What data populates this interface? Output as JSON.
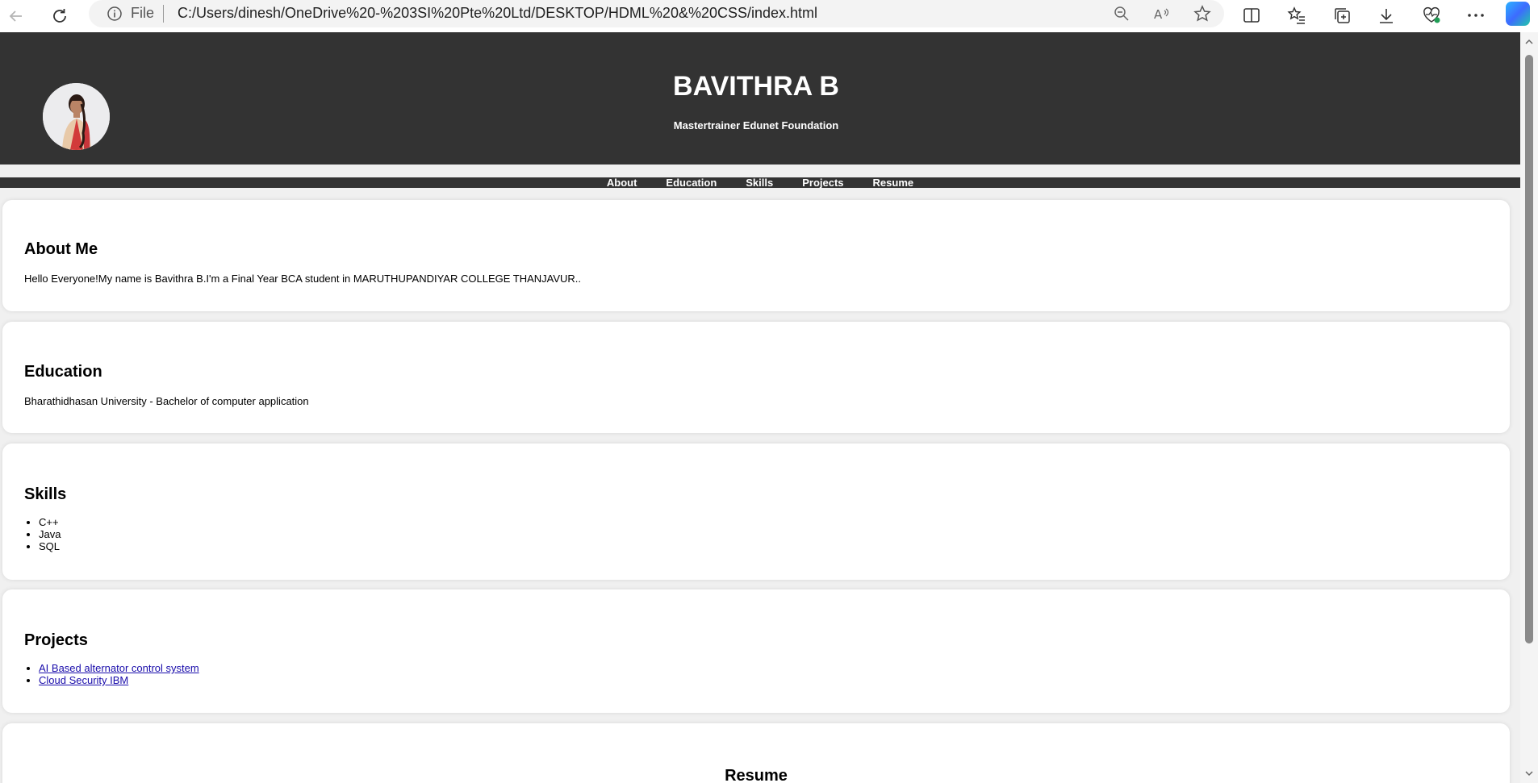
{
  "browser": {
    "address_prefix": "File",
    "url": "C:/Users/dinesh/OneDrive%20-%203SI%20Pte%20Ltd/DESKTOP/HDML%20&%20CSS/index.html"
  },
  "header": {
    "name": "BAVITHRA B",
    "tagline": "Mastertrainer Edunet Foundation"
  },
  "nav": {
    "items": [
      {
        "label": "About"
      },
      {
        "label": "Education"
      },
      {
        "label": "Skills"
      },
      {
        "label": "Projects"
      },
      {
        "label": "Resume"
      }
    ]
  },
  "about": {
    "title": "About Me",
    "text": "Hello Everyone!My name is Bavithra B.I'm a Final Year BCA student in MARUTHUPANDIYAR COLLEGE THANJAVUR.."
  },
  "education": {
    "title": "Education",
    "text": "Bharathidhasan University - Bachelor of computer application"
  },
  "skills": {
    "title": "Skills",
    "items": [
      "C++",
      "Java",
      "SQL"
    ]
  },
  "projects": {
    "title": "Projects",
    "items": [
      "AI Based alternator control system",
      "Cloud Security IBM"
    ]
  },
  "resume": {
    "title": "Resume"
  }
}
